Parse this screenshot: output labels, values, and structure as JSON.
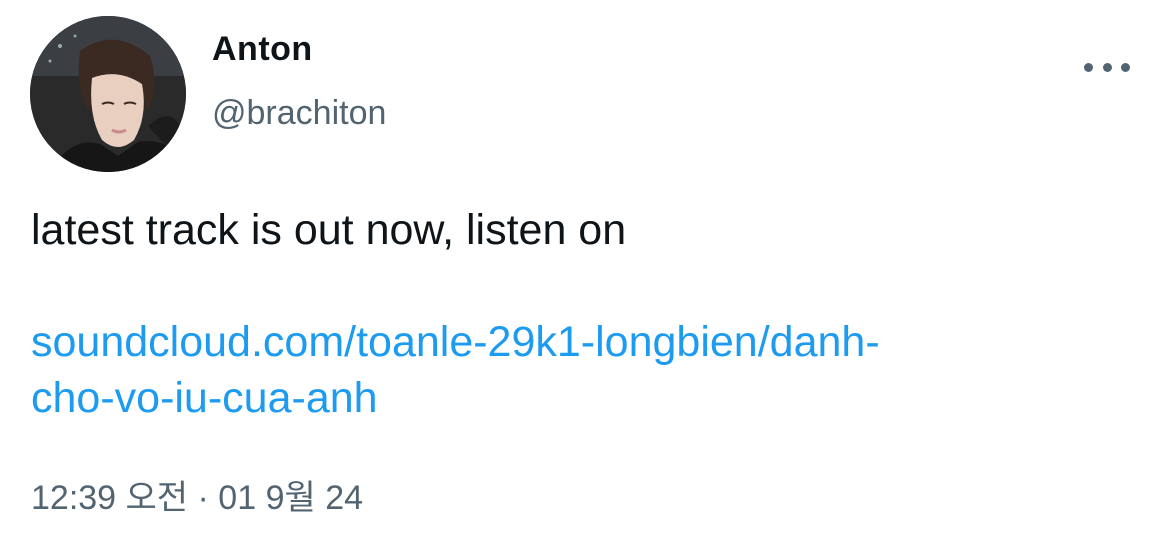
{
  "author": {
    "display_name": "Anton",
    "handle": "@brachiton"
  },
  "menu": {
    "icon": "more-horizontal-icon"
  },
  "tweet": {
    "text": "latest track is out now, listen on",
    "link_line1": "soundcloud.com/toanle-29k1-longbien/danh-",
    "link_line2": "cho-vo-iu-cua-anh",
    "timestamp": "12:39 오전 · 01 9월 24"
  },
  "colors": {
    "text": "#0f1419",
    "secondary": "#536471",
    "link": "#1d9bf0"
  }
}
